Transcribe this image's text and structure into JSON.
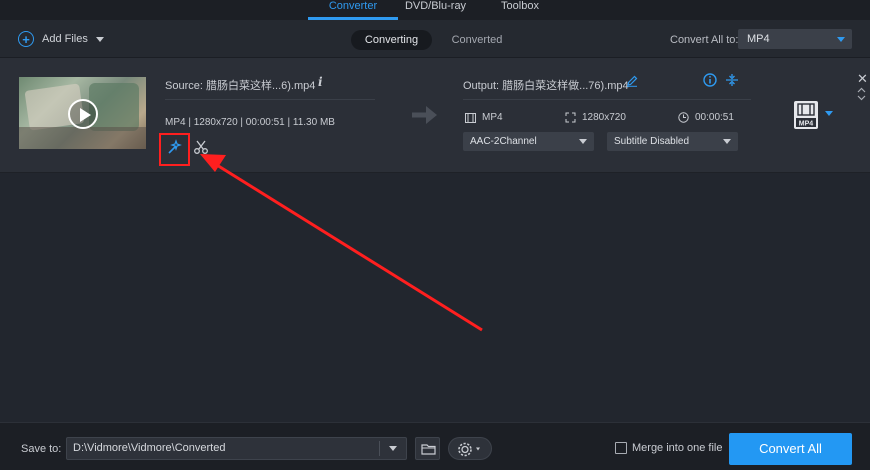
{
  "nav": {
    "tabs": [
      {
        "label": "Converter"
      },
      {
        "label": "DVD/Blu-ray"
      },
      {
        "label": "Toolbox"
      }
    ]
  },
  "toolbar": {
    "add_files_label": "Add Files",
    "status_tabs": [
      {
        "label": "Converting"
      },
      {
        "label": "Converted"
      }
    ],
    "convert_all_to_label": "Convert All to:",
    "convert_all_format": "MP4"
  },
  "file": {
    "source_label": "Source: 腊肠白菜这样...6).mp4",
    "meta": "MP4 | 1280x720 | 00:00:51 | 11.30 MB",
    "output_label": "Output: 腊肠白菜这样做...76).mp4",
    "out_format": "MP4",
    "out_resolution": "1280x720",
    "out_duration": "00:00:51",
    "audio_option": "AAC-2Channel",
    "subtitle_option": "Subtitle Disabled",
    "badge_text": "MP4"
  },
  "bottom": {
    "save_to_label": "Save to:",
    "save_path": "D:\\Vidmore\\Vidmore\\Converted",
    "merge_label": "Merge into one file",
    "convert_all_button": "Convert All"
  },
  "colors": {
    "accent": "#2f9af0",
    "highlight": "#ff1f1f",
    "button": "#2398f3"
  }
}
